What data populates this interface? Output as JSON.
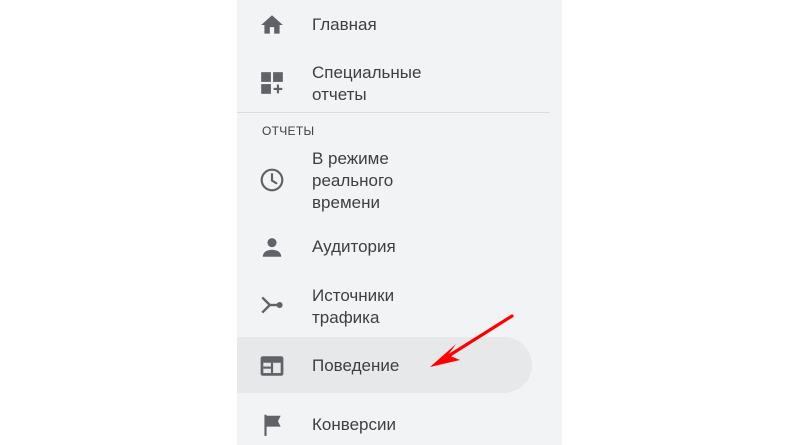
{
  "nav": {
    "home": {
      "label": "Главная",
      "icon": "home-icon"
    },
    "custom_reports": {
      "label": "Специальные\nотчеты",
      "icon": "dashboard-add-icon"
    }
  },
  "reports": {
    "section_label": "ОТЧЕТЫ",
    "items": [
      {
        "label": "В режиме\nреального\nвремени",
        "icon": "clock-icon"
      },
      {
        "label": "Аудитория",
        "icon": "person-icon"
      },
      {
        "label": "Источники\nтрафика",
        "icon": "fork-icon"
      },
      {
        "label": "Поведение",
        "icon": "web-layout-icon",
        "active": true
      },
      {
        "label": "Конверсии",
        "icon": "flag-icon"
      }
    ]
  },
  "annotation": {
    "arrow_color": "#ff0000",
    "icon": "red-arrow-icon"
  },
  "colors": {
    "sidebar_bg": "#f1f3f4",
    "active_bg": "#e6e8ea",
    "icon": "#5f6368",
    "text": "#3c4043"
  }
}
